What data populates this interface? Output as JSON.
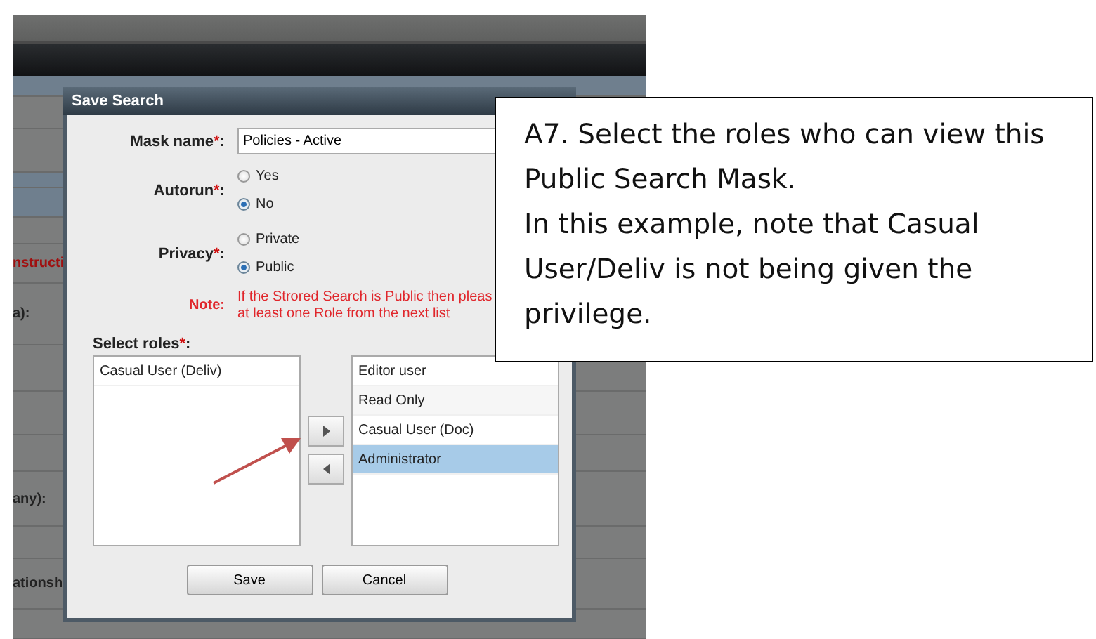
{
  "background": {
    "fragments": [
      {
        "text": "nstructi",
        "kind": "alert"
      },
      {
        "text": "a):",
        "kind": "plain"
      },
      {
        "text": "any):",
        "kind": "plain"
      },
      {
        "text": "ationsh",
        "kind": "plain"
      }
    ]
  },
  "dialog": {
    "title": "Save Search",
    "mask_name": {
      "label": "Mask name",
      "asterisk": "*",
      "colon": ":",
      "value": "Policies - Active"
    },
    "autorun": {
      "label": "Autorun",
      "asterisk": "*",
      "colon": ":",
      "options": [
        {
          "label": "Yes",
          "selected": false
        },
        {
          "label": "No",
          "selected": true
        }
      ]
    },
    "privacy": {
      "label": "Privacy",
      "asterisk": "*",
      "colon": ":",
      "options": [
        {
          "label": "Private",
          "selected": false
        },
        {
          "label": "Public",
          "selected": true
        }
      ]
    },
    "note": {
      "label": "Note:",
      "lines": [
        "If the Strored Search is Public then pleas",
        "at least one Role from the next list"
      ]
    },
    "roles": {
      "label": "Select roles",
      "asterisk": "*",
      "colon": ":",
      "available": [
        {
          "label": "Casual User (Deliv)",
          "selected": false
        }
      ],
      "chosen": [
        {
          "label": "Editor user",
          "selected": false
        },
        {
          "label": "Read Only",
          "selected": false
        },
        {
          "label": "Casual User (Doc)",
          "selected": false
        },
        {
          "label": "Administrator",
          "selected": true
        }
      ]
    },
    "buttons": [
      "Save",
      "Cancel"
    ]
  },
  "callout": {
    "paragraphs": [
      "A7. Select the roles who can view this Public Search Mask.",
      "In this example, note that Casual User/Deliv is not being given the privilege."
    ]
  }
}
